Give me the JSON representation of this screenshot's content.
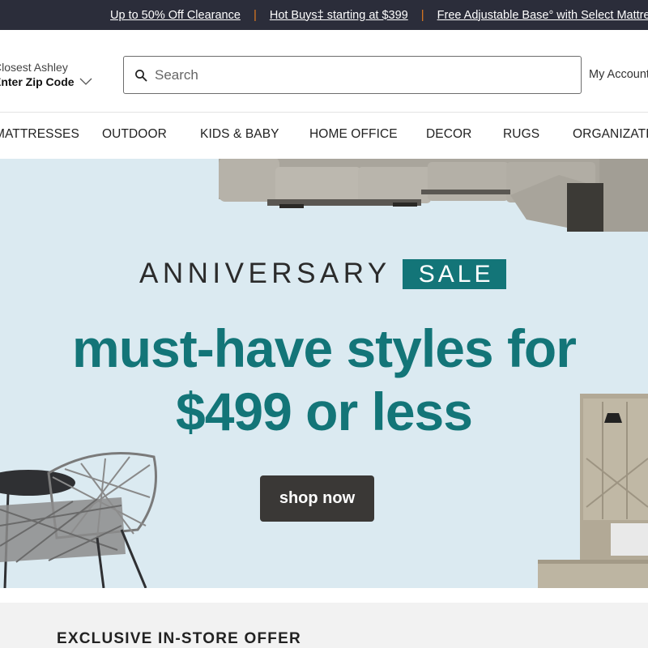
{
  "promo": {
    "items": [
      {
        "label": "Up to 50% Off Clearance"
      },
      {
        "label": "Hot Buys‡ starting at $399"
      },
      {
        "label": "Free Adjustable Base° with Select Mattresses"
      }
    ],
    "separator": "|",
    "accent_color": "#e07a1f"
  },
  "header": {
    "store_label": "Closest Ashley",
    "zip_label": "Enter Zip Code",
    "search_placeholder": "Search",
    "search_value": "",
    "account_label": "My Account"
  },
  "nav": {
    "items": [
      {
        "label": "MATTRESSES"
      },
      {
        "label": "OUTDOOR"
      },
      {
        "label": "KIDS & BABY"
      },
      {
        "label": "HOME OFFICE"
      },
      {
        "label": "DECOR"
      },
      {
        "label": "RUGS"
      },
      {
        "label": "ORGANIZATION"
      }
    ]
  },
  "hero": {
    "eyebrow": "ANNIVERSARY",
    "badge": "SALE",
    "headline_line1": "must-have styles for",
    "headline_line2": "$499 or less",
    "cta_label": "shop now",
    "background_color": "#dbeaf1",
    "accent_color": "#137578"
  },
  "offer": {
    "title": "EXCLUSIVE IN-STORE OFFER"
  }
}
